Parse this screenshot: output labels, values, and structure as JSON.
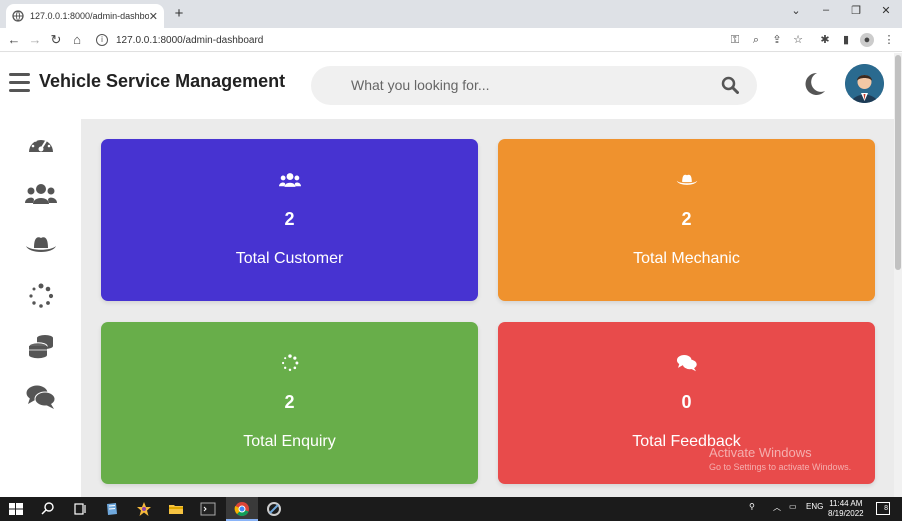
{
  "browser": {
    "tab_title": "127.0.0.1:8000/admin-dashboard",
    "url": "127.0.0.1:8000/admin-dashboard"
  },
  "header": {
    "brand": "Vehicle Service Management",
    "search_placeholder": "What you looking for..."
  },
  "sidebar": {
    "items": [
      {
        "icon": "dashboard-gauge-icon"
      },
      {
        "icon": "users-icon"
      },
      {
        "icon": "hat-icon"
      },
      {
        "icon": "spinner-icon"
      },
      {
        "icon": "coins-icon"
      },
      {
        "icon": "comments-icon"
      }
    ]
  },
  "cards": [
    {
      "icon": "users-icon",
      "value": "2",
      "label": "Total Customer",
      "color": "#4733d1"
    },
    {
      "icon": "hat-icon",
      "value": "2",
      "label": "Total Mechanic",
      "color": "#ef922e"
    },
    {
      "icon": "spinner-icon",
      "value": "2",
      "label": "Total Enquiry",
      "color": "#68ae4a"
    },
    {
      "icon": "comments-icon",
      "value": "0",
      "label": "Total Feedback",
      "color": "#e84b4b"
    }
  ],
  "watermark": {
    "line1": "Activate Windows",
    "line2": "Go to Settings to activate Windows."
  },
  "taskbar": {
    "lang": "ENG",
    "time": "11:44 AM",
    "date": "8/19/2022",
    "notifications": "8"
  }
}
